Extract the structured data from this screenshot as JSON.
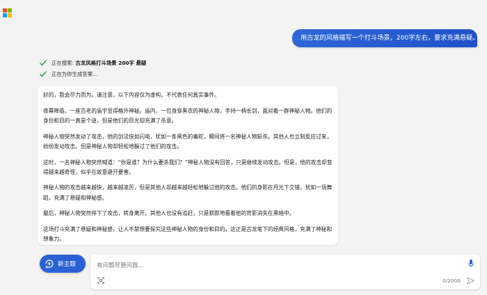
{
  "app": {
    "logo_colors": [
      "#f25022",
      "#7fba00",
      "#00a4ef",
      "#ffb900"
    ]
  },
  "conversation": {
    "user_message": "用古龙的风格描写一个打斗场景，200字左右，要求充满悬疑。",
    "status": [
      {
        "label": "正在搜索: ",
        "value": "古龙风格打斗场景 200字 悬疑",
        "icon": "check-icon"
      },
      {
        "label": "正在为你生成答案...",
        "value": "",
        "icon": "check-icon"
      }
    ],
    "answer_paragraphs": [
      "好的，我会尽力而为。请注意，以下内容仅为虚构，不代表任何真实事件。",
      "夜幕降临，一座古老的庙宇显得格外神秘。庙内，一位身穿黑衣的神秘人物，手持一柄长剑，面对着一群神秘人物。他们的身份和目的一直是个谜，但是他们的目光却充满了杀意。",
      "神秘人物突然发动了攻击，他的剑法快如闪电，犹如一条黑色的毒蛇，瞬间将一名神秘人物斩杀。其他人也立刻反应过来，纷纷发动攻击。但是神秘人物却轻松地躲过了他们的攻击。",
      "这时，一名神秘人物突然喊道：“你是谁？为什么要杀我们？”神秘人物没有回答，只是继续发动攻击。但是，他的攻击却变得越来越奇怪，似乎在故意避开要害。",
      "神秘人物的攻击越来越快，越来越凌厉，但是其他人却越来越轻松地躲过他的攻击。他们的身影在月光下交错，犹如一场舞蹈，充满了悬疑和神秘感。",
      "最后，神秘人物突然停下了攻击，转身离开。其他人也没有追赶，只是默默地看着他的背影消失在黑暗中。",
      "这场打斗充满了悬疑和神秘感，让人不禁想要探究这些神秘人物的身份和目的。这正是古龙笔下的经典风格，充满了神秘和想象力。"
    ]
  },
  "composer": {
    "new_topic_label": "新主题",
    "placeholder": "有问题尽管问我...",
    "char_count": "0/2000",
    "accent": "#2a62d6"
  }
}
